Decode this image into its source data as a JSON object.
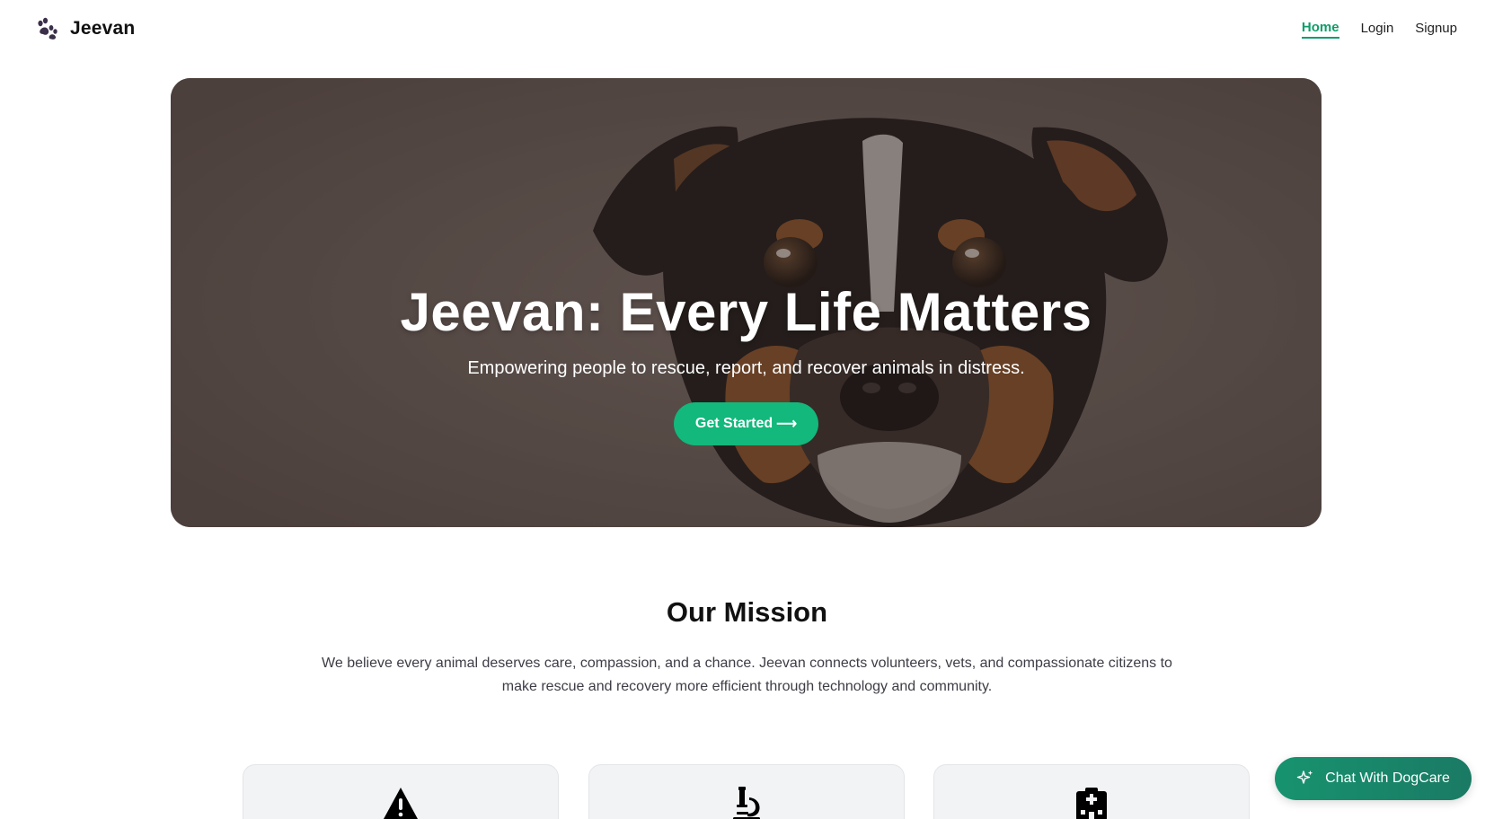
{
  "nav": {
    "brand": "Jeevan",
    "brand_icon": "paw-icon",
    "links": [
      {
        "label": "Home",
        "active": true
      },
      {
        "label": "Login",
        "active": false
      },
      {
        "label": "Signup",
        "active": false
      }
    ]
  },
  "hero": {
    "title": "Jeevan: Every Life Matters",
    "subtitle": "Empowering people to rescue, report, and recover animals in distress.",
    "cta_label": "Get Started",
    "cta_arrow": "⟶",
    "background": "dog-photo"
  },
  "mission": {
    "title": "Our Mission",
    "text": "We believe every animal deserves care, compassion, and a chance. Jeevan connects volunteers, vets, and compassionate citizens to make rescue and recovery more efficient through technology and community."
  },
  "cards": [
    {
      "icon": "warning-icon"
    },
    {
      "icon": "microscope-icon"
    },
    {
      "icon": "hospital-icon"
    }
  ],
  "chat": {
    "label": "Chat With DogCare",
    "icon": "sparkle-icon"
  },
  "colors": {
    "accent": "#12b87c",
    "nav_active": "#0f9d6a",
    "chat_button": "#17936f",
    "hero_tint": "#5f5450",
    "card_background": "#f2f3f5"
  }
}
